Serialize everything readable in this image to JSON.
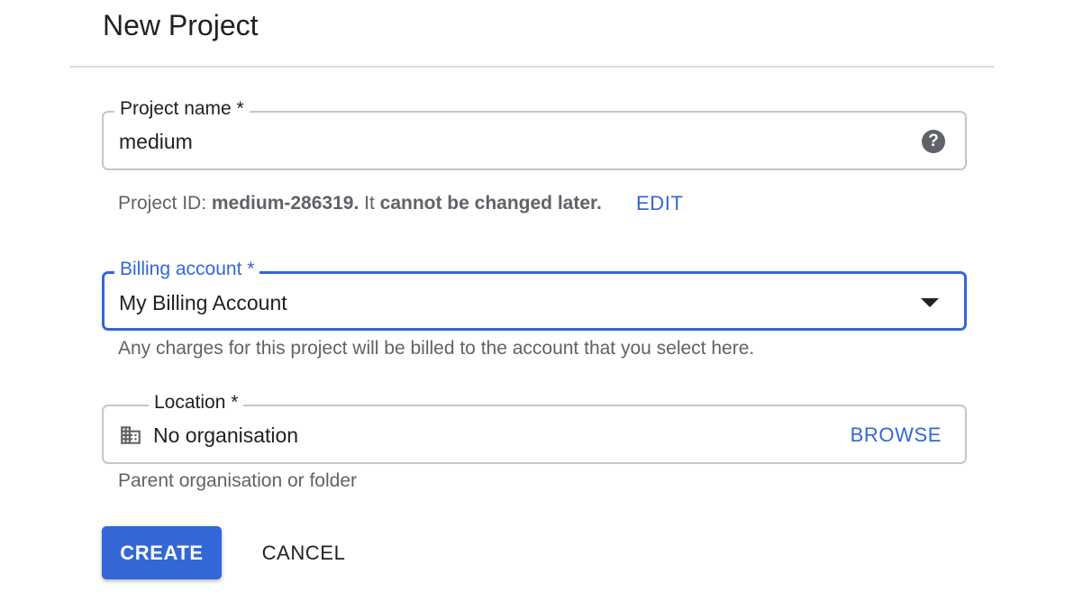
{
  "dialog": {
    "title": "New Project"
  },
  "project_name": {
    "label": "Project name *",
    "value": "medium",
    "help_icon": "help-circle-icon",
    "hint_prefix": "Project ID: ",
    "project_id": "medium-286319.",
    "hint_middle": " It ",
    "hint_bold_suffix": "cannot be changed later.",
    "edit_label": "EDIT"
  },
  "billing_account": {
    "label": "Billing account *",
    "value": "My Billing Account",
    "dropdown_icon": "arrow-drop-down-icon",
    "hint": "Any charges for this project will be billed to the account that you select here."
  },
  "location": {
    "label": "Location *",
    "value": "No organisation",
    "icon": "building-icon",
    "browse_label": "BROWSE",
    "hint": "Parent organisation or folder"
  },
  "actions": {
    "create_label": "CREATE",
    "cancel_label": "CANCEL"
  },
  "colors": {
    "accent": "#3367d6",
    "text": "#202124",
    "secondary_text": "#5f6368",
    "border": "#c4c7c5"
  }
}
